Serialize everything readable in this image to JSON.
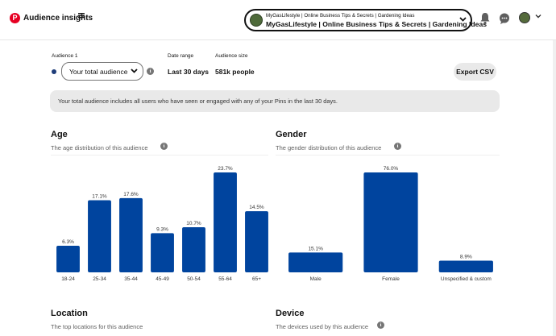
{
  "header": {
    "logo_letter": "P",
    "title": "Audience insights",
    "menu_icon": "hamburger-icon",
    "account": {
      "subtitle": "MyGasLifestyle | Online Business Tips & Secrets | Gardening Ideas",
      "name": "MyGasLifestyle | Online Business Tips & Secrets | Gardening Ideas"
    }
  },
  "filters": {
    "audience_label": "Audience 1",
    "audience_value": "Your total audience",
    "date_label": "Date range",
    "date_value": "Last 30 days",
    "size_label": "Audience size",
    "size_value": "581k people",
    "export_label": "Export CSV"
  },
  "banner": {
    "text": "Your total audience includes all users who have seen or engaged with any of your Pins in the last 30 days."
  },
  "age": {
    "title": "Age",
    "subtitle": "The age distribution of this audience"
  },
  "gender": {
    "title": "Gender",
    "subtitle": "The gender distribution of this audience"
  },
  "location": {
    "title": "Location",
    "subtitle": "The top locations for this audience"
  },
  "device": {
    "title": "Device",
    "subtitle": "The devices used by this audience"
  },
  "colors": {
    "bar": "#00449e",
    "brand": "#e60023"
  },
  "chart_data": [
    {
      "type": "bar",
      "title": "Age",
      "categories": [
        "18-24",
        "25-34",
        "35-44",
        "45-49",
        "50-54",
        "55-64",
        "65+"
      ],
      "values": [
        6.3,
        17.1,
        17.6,
        9.3,
        10.7,
        23.7,
        14.5
      ],
      "labels": [
        "6.3%",
        "17.1%",
        "17.6%",
        "9.3%",
        "10.7%",
        "23.7%",
        "14.5%"
      ],
      "ylim": [
        0,
        23.7
      ]
    },
    {
      "type": "bar",
      "title": "Gender",
      "categories": [
        "Male",
        "Female",
        "Unspecified & custom"
      ],
      "values": [
        15.1,
        76.0,
        8.9
      ],
      "labels": [
        "15.1%",
        "76.0%",
        "8.9%"
      ],
      "ylim": [
        0,
        76.0
      ]
    }
  ]
}
